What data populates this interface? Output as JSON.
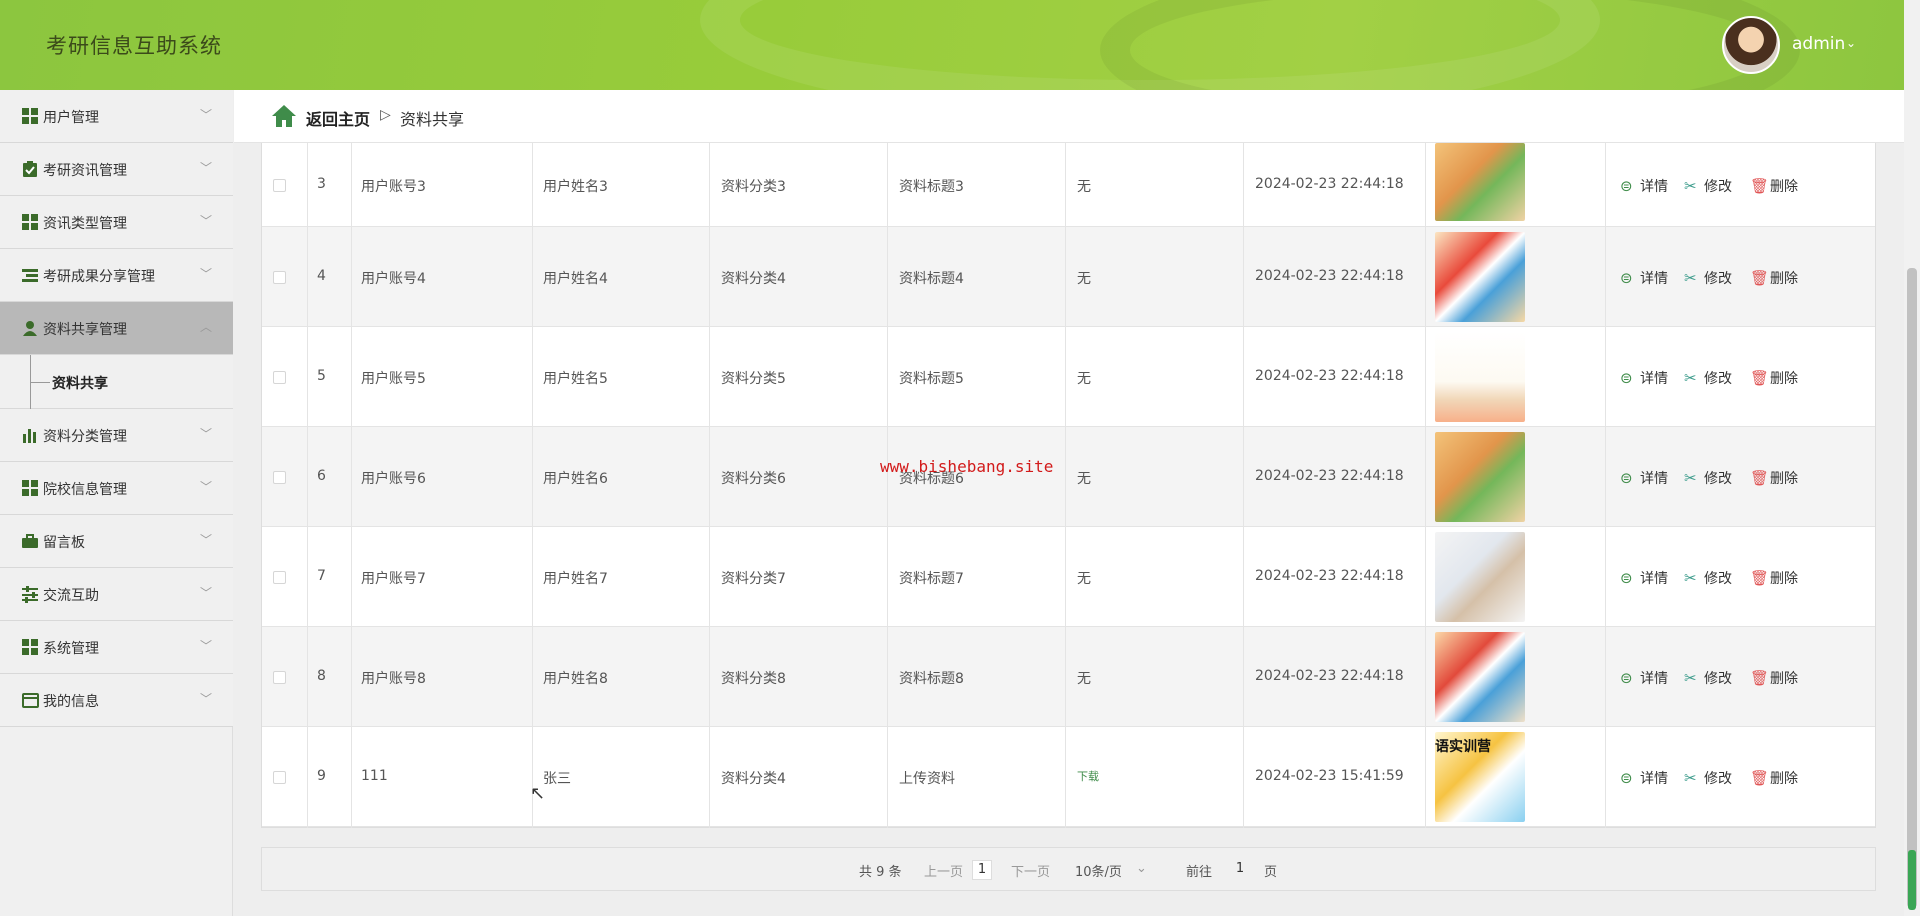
{
  "header": {
    "title": "考研信息互助系统",
    "username": "admin",
    "caret": "⌄"
  },
  "sidebar": {
    "items": [
      {
        "label": "用户管理",
        "icon": "grid-icon"
      },
      {
        "label": "考研资讯管理",
        "icon": "clipboard-check-icon"
      },
      {
        "label": "资讯类型管理",
        "icon": "grid-icon"
      },
      {
        "label": "考研成果分享管理",
        "icon": "list-icon"
      },
      {
        "label": "资料共享管理",
        "icon": "user-icon"
      },
      {
        "label": "资料分类管理",
        "icon": "bar-chart-icon"
      },
      {
        "label": "院校信息管理",
        "icon": "grid-icon"
      },
      {
        "label": "留言板",
        "icon": "briefcase-icon"
      },
      {
        "label": "交流互助",
        "icon": "sliders-icon"
      },
      {
        "label": "系统管理",
        "icon": "grid-icon"
      },
      {
        "label": "我的信息",
        "icon": "card-icon"
      }
    ],
    "submenu_label": "资料共享"
  },
  "breadcrumb": {
    "home": "返回主页",
    "separator": "▷",
    "current": "资料共享"
  },
  "table": {
    "rows": [
      {
        "index": "3",
        "account": "用户账号3",
        "name": "用户姓名3",
        "category": "资料分类3",
        "title": "资料标题3",
        "file": "无",
        "time": "2024-02-23 22:44:18",
        "thumb": "t1"
      },
      {
        "index": "4",
        "account": "用户账号4",
        "name": "用户姓名4",
        "category": "资料分类4",
        "title": "资料标题4",
        "file": "无",
        "time": "2024-02-23 22:44:18",
        "thumb": "t2"
      },
      {
        "index": "5",
        "account": "用户账号5",
        "name": "用户姓名5",
        "category": "资料分类5",
        "title": "资料标题5",
        "file": "无",
        "time": "2024-02-23 22:44:18",
        "thumb": "t3"
      },
      {
        "index": "6",
        "account": "用户账号6",
        "name": "用户姓名6",
        "category": "资料分类6",
        "title": "资料标题6",
        "file": "无",
        "time": "2024-02-23 22:44:18",
        "thumb": "t1"
      },
      {
        "index": "7",
        "account": "用户账号7",
        "name": "用户姓名7",
        "category": "资料分类7",
        "title": "资料标题7",
        "file": "无",
        "time": "2024-02-23 22:44:18",
        "thumb": "t4"
      },
      {
        "index": "8",
        "account": "用户账号8",
        "name": "用户姓名8",
        "category": "资料分类8",
        "title": "资料标题8",
        "file": "无",
        "time": "2024-02-23 22:44:18",
        "thumb": "t6"
      },
      {
        "index": "9",
        "account": "111",
        "name": "张三",
        "category": "资料分类4",
        "title": "上传资料",
        "file": "下载",
        "time": "2024-02-23 15:41:59",
        "thumb": "t5"
      }
    ],
    "thumb_caption": "语实训营",
    "actions": {
      "view": "详情",
      "edit": "修改",
      "delete": "删除"
    }
  },
  "watermark": "www.bishebang.site",
  "pagination": {
    "total": "共 9 条",
    "prev": "上一页",
    "page": "1",
    "next": "下一页",
    "page_size": "10条/页",
    "goto_prefix": "前往",
    "goto_value": "1",
    "goto_suffix": "页"
  },
  "colors": {
    "header_green": "#98cc3a",
    "accent_green": "#3f8c4a",
    "delete_red": "#e05656",
    "watermark_red": "#d21a1a"
  }
}
